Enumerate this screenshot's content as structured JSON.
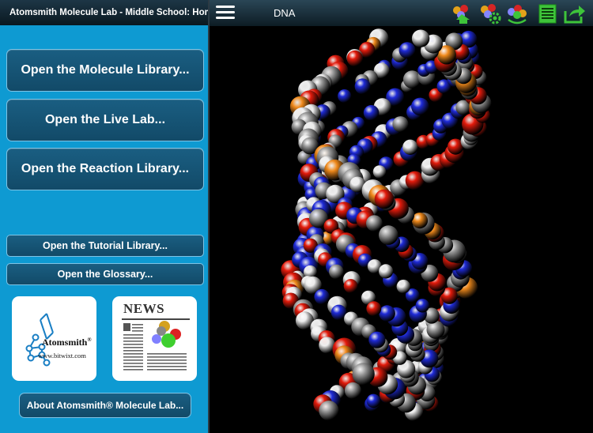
{
  "sidebar": {
    "title": "Atomsmith Molecule Lab - Middle School: Home",
    "buttons": {
      "molecule_library": "Open the Molecule Library...",
      "live_lab": "Open the Live Lab...",
      "reaction_library": "Open the Reaction Library...",
      "tutorial_library": "Open the Tutorial Library...",
      "glossary": "Open the Glossary..."
    },
    "tiles": {
      "atomsmith_name": "Atomsmith",
      "atomsmith_mark": "®",
      "atomsmith_url": "www.bitwixt.com",
      "news_label": "NEWS"
    },
    "about_button": "About Atomsmith® Molecule Lab..."
  },
  "viewer": {
    "title": "DNA",
    "toolbar_icons": [
      "molecule-home-icon",
      "molecule-settings-icon",
      "molecule-refresh-icon",
      "document-list-icon",
      "share-icon"
    ]
  },
  "colors": {
    "sidebar_bg": "#0e9ad2",
    "button_bg": "#145476",
    "carbon": "#9a9a9a",
    "hydrogen": "#eeeeee",
    "oxygen": "#e31b0c",
    "nitrogen": "#1f2bd8",
    "phosphorus": "#f08a1c"
  }
}
